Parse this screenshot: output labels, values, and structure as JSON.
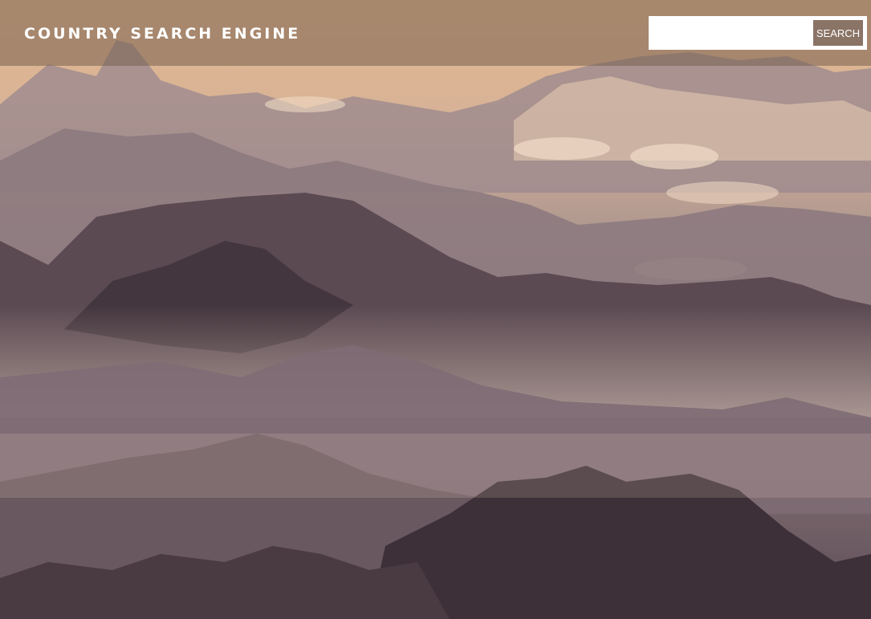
{
  "header": {
    "site_title": "COUNTRY SEARCH ENGINE"
  },
  "search": {
    "value": "",
    "placeholder": "",
    "button_label": "SEARCH"
  },
  "background": {
    "description_icon": "mountain-landscape-image"
  },
  "colors": {
    "header_bar": "#78604f",
    "button": "#8a7466",
    "text": "#ffffff"
  }
}
